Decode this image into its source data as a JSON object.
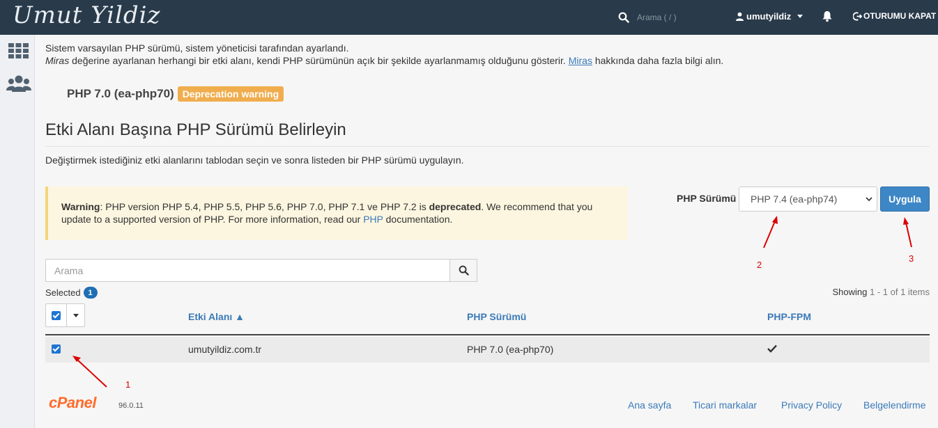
{
  "header": {
    "logo_text": "Umut Yildiz",
    "search_placeholder": "Arama ( / )",
    "username": "umutyildiz",
    "logout_label": "OTURUMU KAPAT"
  },
  "info": {
    "line1": "Sistem varsayılan PHP sürümü, sistem yöneticisi tarafından ayarlandı.",
    "line2_italic": "Miras",
    "line2_middle": " değerine ayarlanan herhangi bir etki alanı, kendi PHP sürümünün açık bir şekilde ayarlanmamış olduğunu gösterir. ",
    "line2_link": "Miras",
    "line2_end": " hakkında daha fazla bilgi alın."
  },
  "system_php": {
    "version": "PHP 7.0 (ea-php70)",
    "badge": "Deprecation warning"
  },
  "section": {
    "title": "Etki Alanı Başına PHP Sürümü Belirleyin",
    "description": "Değiştirmek istediğiniz etki alanlarını tablodan seçin ve sonra listeden bir PHP sürümü uygulayın."
  },
  "warning": {
    "label": "Warning",
    "text1": ": PHP version PHP 5.4, PHP 5.5, PHP 5.6, PHP 7.0, PHP 7.1 ve PHP 7.2 is ",
    "strong": "deprecated",
    "text2": ". We recommend that you update to a supported version of PHP. For more information, read our ",
    "link": "PHP",
    "text3": " documentation."
  },
  "php_selector": {
    "label": "PHP Sürümü",
    "selected": "PHP 7.4 (ea-php74)",
    "apply_label": "Uygula"
  },
  "table": {
    "search_placeholder": "Arama",
    "selected_label": "Selected",
    "selected_count": "1",
    "showing_label": "Showing",
    "showing_range": "1 - 1 of 1 items",
    "columns": {
      "domain": "Etki Alanı ▲",
      "php": "PHP Sürümü",
      "fpm": "PHP-FPM"
    },
    "rows": [
      {
        "domain": "umutyildiz.com.tr",
        "php": "PHP 7.0 (ea-php70)",
        "fpm": true,
        "checked": true
      }
    ]
  },
  "annotations": [
    "1",
    "2",
    "3"
  ],
  "footer": {
    "logo": "cPanel",
    "version": "96.0.11",
    "links": [
      "Ana sayfa",
      "Ticari markalar",
      "Privacy Policy",
      "Belgelendirme"
    ]
  }
}
